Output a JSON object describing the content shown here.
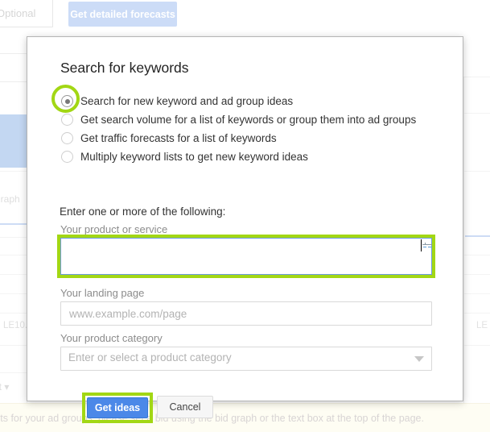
{
  "background": {
    "optional_field_placeholder": "Optional",
    "detailed_forecasts_button": "Get detailed forecasts",
    "graph_label": "graph",
    "le10_label": "LE10.",
    "le_label_right": "LE",
    "it_label": "it",
    "notice_text": "sts for your ad groups, please set a bid using the bid graph or the text box at the top of the page.",
    "colors": {
      "forecast_button_bg": "#ccdcf7",
      "notice_bg": "#fefdf3",
      "highlight_block": "#c3d7f2"
    }
  },
  "dialog": {
    "title": "Search for keywords",
    "radio_group": {
      "selected_index": 0,
      "options": [
        {
          "label": "Search for new keyword and ad group ideas",
          "checked": true,
          "highlighted": true
        },
        {
          "label": "Get search volume for a list of keywords or group them into ad groups",
          "checked": false,
          "highlighted": false
        },
        {
          "label": "Get traffic forecasts for a list of keywords",
          "checked": false,
          "highlighted": false
        },
        {
          "label": "Multiply keyword lists to get new keyword ideas",
          "checked": false,
          "highlighted": false
        }
      ]
    },
    "form": {
      "intro": "Enter one or more of the following:",
      "product_service": {
        "label": "Your product or service",
        "value": "",
        "placeholder": "",
        "focused": true,
        "highlighted": true
      },
      "landing_page": {
        "label": "Your landing page",
        "value": "",
        "placeholder": "www.example.com/page"
      },
      "product_category": {
        "label": "Your product category",
        "value": "",
        "placeholder": "Enter or select a product category",
        "dropdown_icon": "chevron-down-icon"
      }
    },
    "actions": {
      "submit_label": "Get ideas",
      "submit_highlighted": true,
      "cancel_label": "Cancel"
    },
    "colors": {
      "highlight_green": "#a2d714",
      "primary_button": "#4b88e8",
      "focus_border": "#6b9ae0",
      "title_text": "#222222",
      "label_text": "#8c8c8c"
    }
  }
}
